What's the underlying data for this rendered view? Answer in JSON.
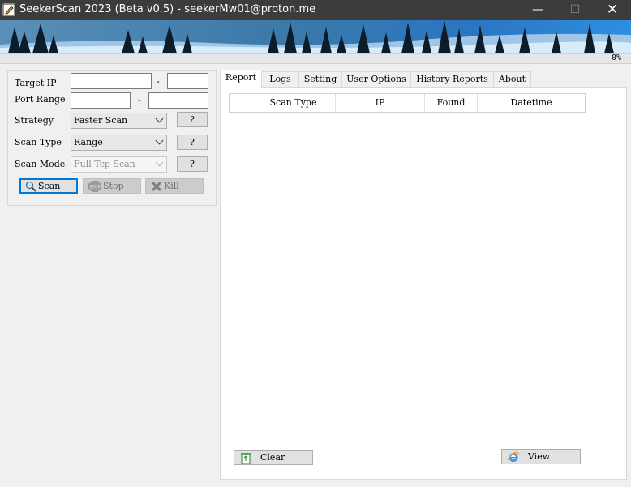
{
  "window": {
    "title": "SeekerScan 2023 (Beta v0.5) - seekerMw01@proton.me",
    "minimize_glyph": "—",
    "maximize_glyph": "☐",
    "close_glyph": "✕"
  },
  "progress": {
    "value": 0,
    "label": "0%"
  },
  "form": {
    "target_ip_label": "Target IP",
    "target_ip_start": "",
    "target_ip_end": "",
    "port_range_label": "Port Range",
    "port_start": "",
    "port_end": "",
    "range_separator": "-",
    "strategy_label": "Strategy",
    "strategy_value": "Faster Scan",
    "scan_type_label": "Scan Type",
    "scan_type_value": "Range",
    "scan_mode_label": "Scan Mode",
    "scan_mode_value": "Full Tcp Scan",
    "help_label": "?"
  },
  "actions": {
    "scan_label": "Scan",
    "stop_label": "Stop",
    "kill_label": "Kill"
  },
  "tabs": [
    {
      "label": "Report",
      "active": true
    },
    {
      "label": "Logs",
      "active": false
    },
    {
      "label": "Setting",
      "active": false
    },
    {
      "label": "User Options",
      "active": false
    },
    {
      "label": "History Reports",
      "active": false
    },
    {
      "label": "About",
      "active": false
    }
  ],
  "report_table": {
    "columns": [
      "",
      "Scan Type",
      "IP",
      "Found",
      "Datetime"
    ],
    "rows": []
  },
  "report_buttons": {
    "clear_label": "Clear",
    "view_label": "View"
  },
  "colors": {
    "titlebar": "#3c3c3c",
    "accent": "#0078d7",
    "progress_green": "#06b025"
  }
}
